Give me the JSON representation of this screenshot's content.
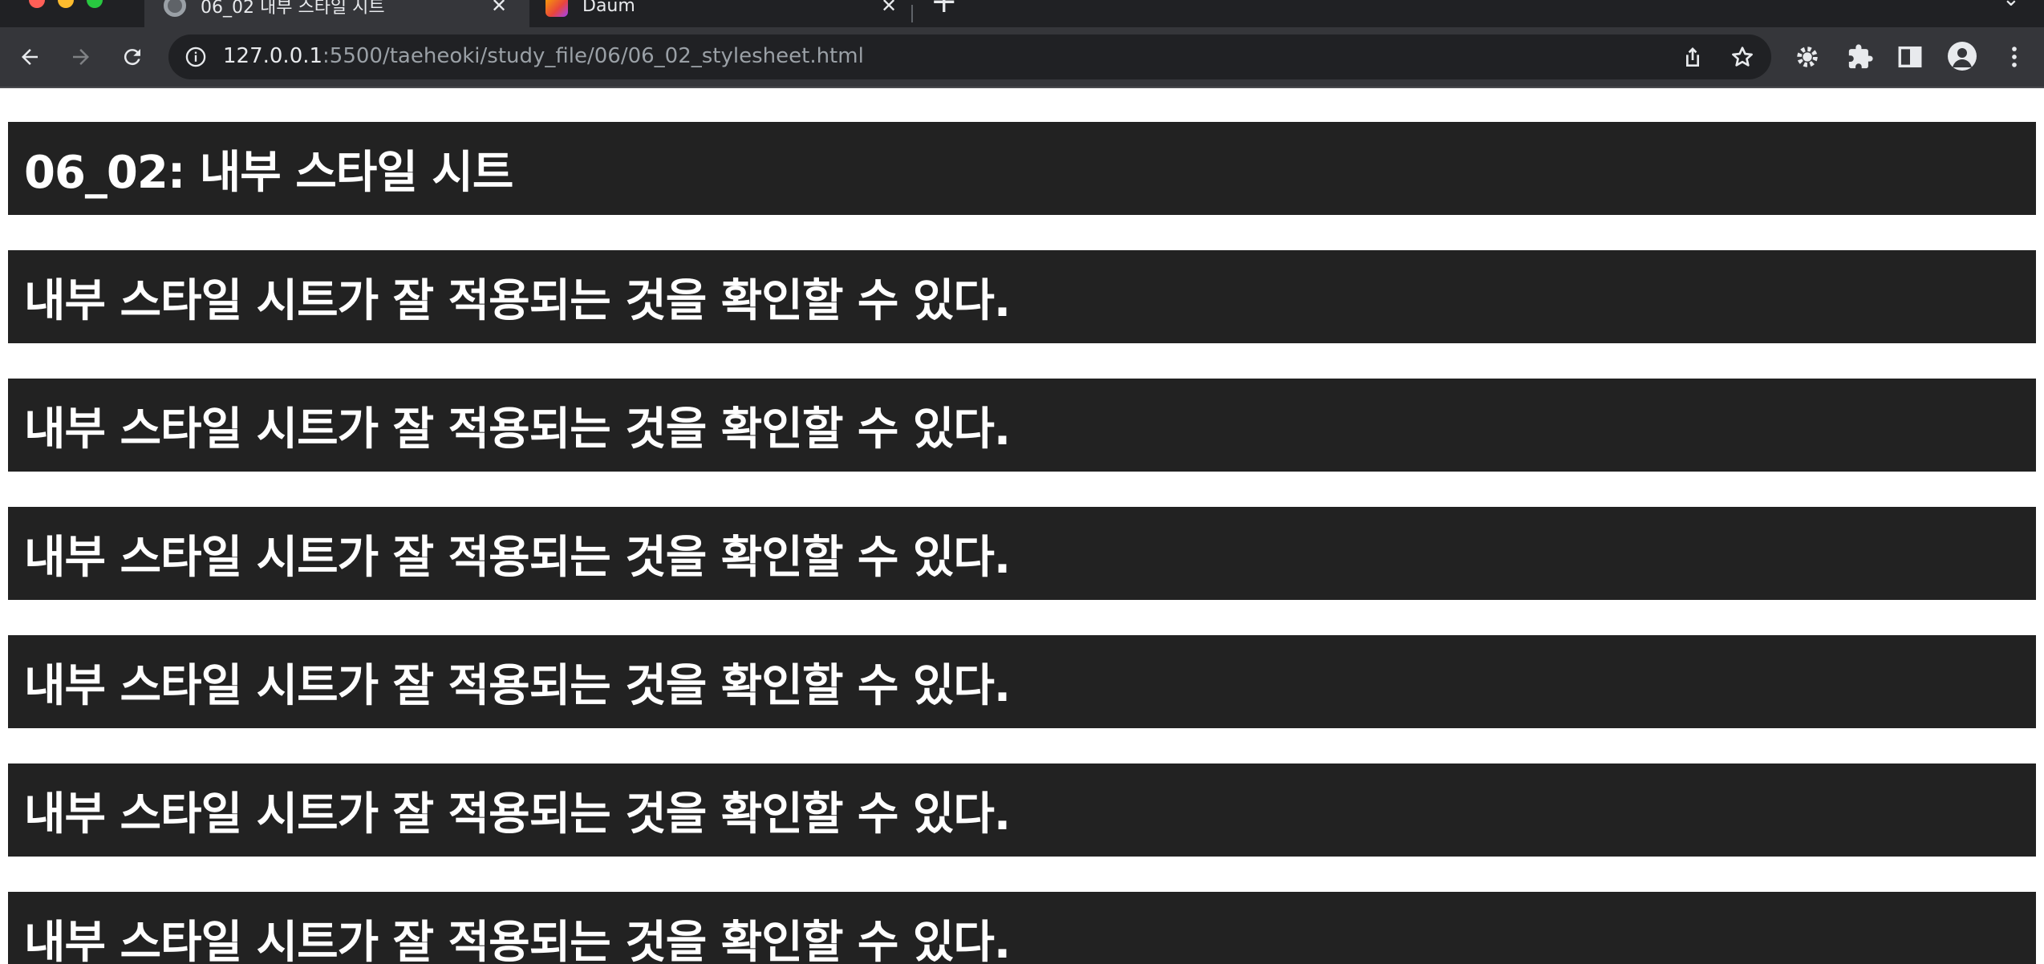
{
  "browser": {
    "tabs": [
      {
        "title": "06_02 내부 스타일 시트",
        "active": true
      },
      {
        "title": "Daum",
        "active": false
      }
    ],
    "address_bar": {
      "host": "127.0.0.1",
      "rest": ":5500/taeheoki/study_file/06/06_02_stylesheet.html"
    },
    "icons": [
      "back-icon",
      "forward-icon",
      "reload-icon",
      "site-info-icon",
      "share-icon",
      "star-icon",
      "extension-gear-icon",
      "puzzle-icon",
      "side-panel-icon",
      "profile-icon",
      "menu-icon"
    ],
    "colors": {
      "tab_strip": "#202124",
      "toolbar": "#35363a",
      "omnibox": "#202124"
    }
  },
  "page": {
    "title_heading": "06_02: 내부 스타일 시트",
    "headings": [
      "내부 스타일 시트가 잘 적용되는 것을 확인할 수 있다.",
      "내부 스타일 시트가 잘 적용되는 것을 확인할 수 있다.",
      "내부 스타일 시트가 잘 적용되는 것을 확인할 수 있다.",
      "내부 스타일 시트가 잘 적용되는 것을 확인할 수 있다.",
      "내부 스타일 시트가 잘 적용되는 것을 확인할 수 있다.",
      "내부 스타일 시트가 잘 적용되는 것을 확인할 수 있다."
    ],
    "colors": {
      "heading_background": "#222222",
      "heading_text": "#ffffff"
    }
  }
}
